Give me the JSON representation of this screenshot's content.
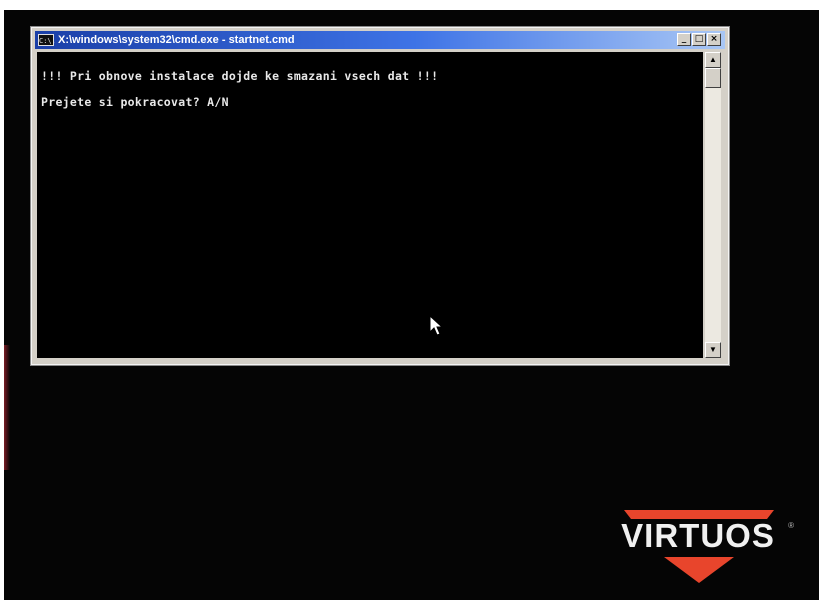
{
  "window": {
    "title": "X:\\windows\\system32\\cmd.exe - startnet.cmd",
    "icon_label": "C:\\.",
    "minimize": "_",
    "maximize": "□",
    "close": "×"
  },
  "console": {
    "lines": [
      "!!! Pri obnove instalace dojde ke smazani vsech dat !!!",
      "Prejete si pokracovat? A/N"
    ],
    "text_color": "#e8e8e8",
    "background": "#000000"
  },
  "scrollbar": {
    "up_arrow": "▲",
    "down_arrow": "▼"
  },
  "logo": {
    "brand": "VIRTUOS",
    "registered": "®",
    "accent_color": "#e8452c"
  },
  "icons": {
    "cursor": "mouse-pointer-icon",
    "window": "cmd-window-icon"
  }
}
